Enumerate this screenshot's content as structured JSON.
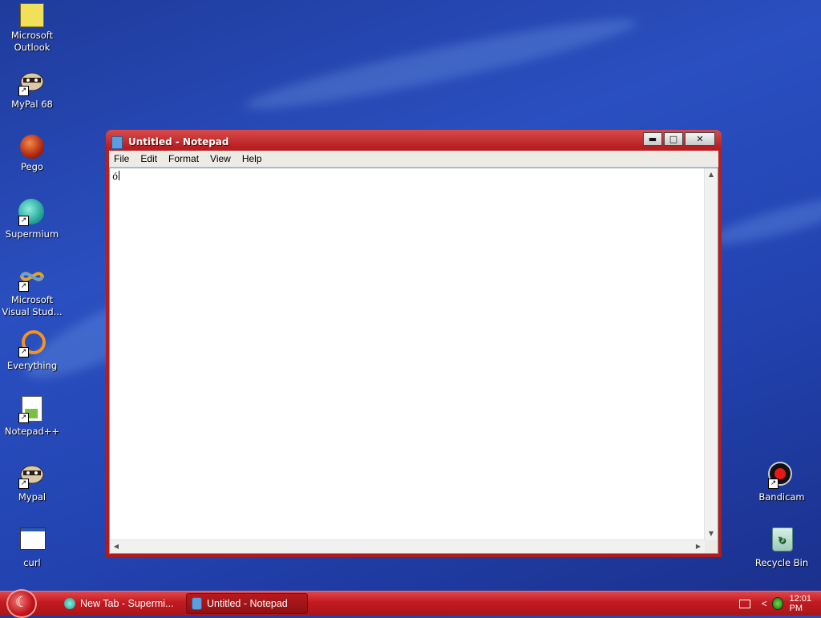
{
  "desktop": {
    "icons_left": [
      {
        "name": "outlook-icon",
        "label_line1": "Microsoft",
        "label_line2": "Outlook"
      },
      {
        "name": "mypal68-icon",
        "label_line1": "MyPal 68",
        "label_line2": ""
      },
      {
        "name": "pego-icon",
        "label_line1": "Pego",
        "label_line2": ""
      },
      {
        "name": "supermium-icon",
        "label_line1": "Supermium",
        "label_line2": ""
      },
      {
        "name": "visual-studio-icon",
        "label_line1": "Microsoft",
        "label_line2": "Visual Stud..."
      },
      {
        "name": "everything-icon",
        "label_line1": "Everything",
        "label_line2": ""
      },
      {
        "name": "notepadpp-icon",
        "label_line1": "Notepad++",
        "label_line2": ""
      },
      {
        "name": "mypal-icon",
        "label_line1": "Mypal",
        "label_line2": ""
      },
      {
        "name": "curl-icon",
        "label_line1": "curl",
        "label_line2": ""
      }
    ],
    "icons_right": [
      {
        "name": "bandicam-icon",
        "label": "Bandicam"
      },
      {
        "name": "recycle-bin-icon",
        "label": "Recycle Bin"
      }
    ]
  },
  "window": {
    "title": "Untitled - Notepad",
    "minimize": "▬",
    "maximize": "□",
    "close": "✕",
    "menus": [
      "File",
      "Edit",
      "Format",
      "View",
      "Help"
    ],
    "content": "ó"
  },
  "taskbar": {
    "tasks": [
      {
        "label": "New Tab - Supermi...",
        "icon": "supermium-icon",
        "active": false
      },
      {
        "label": "Untitled - Notepad",
        "icon": "notepad-icon",
        "active": true
      }
    ],
    "clock": "12:01 PM",
    "tray_chevron": "<"
  },
  "colors": {
    "window_frame": "#b81f22",
    "taskbar": "#c21a20",
    "desktop": "#2a4fc0"
  }
}
